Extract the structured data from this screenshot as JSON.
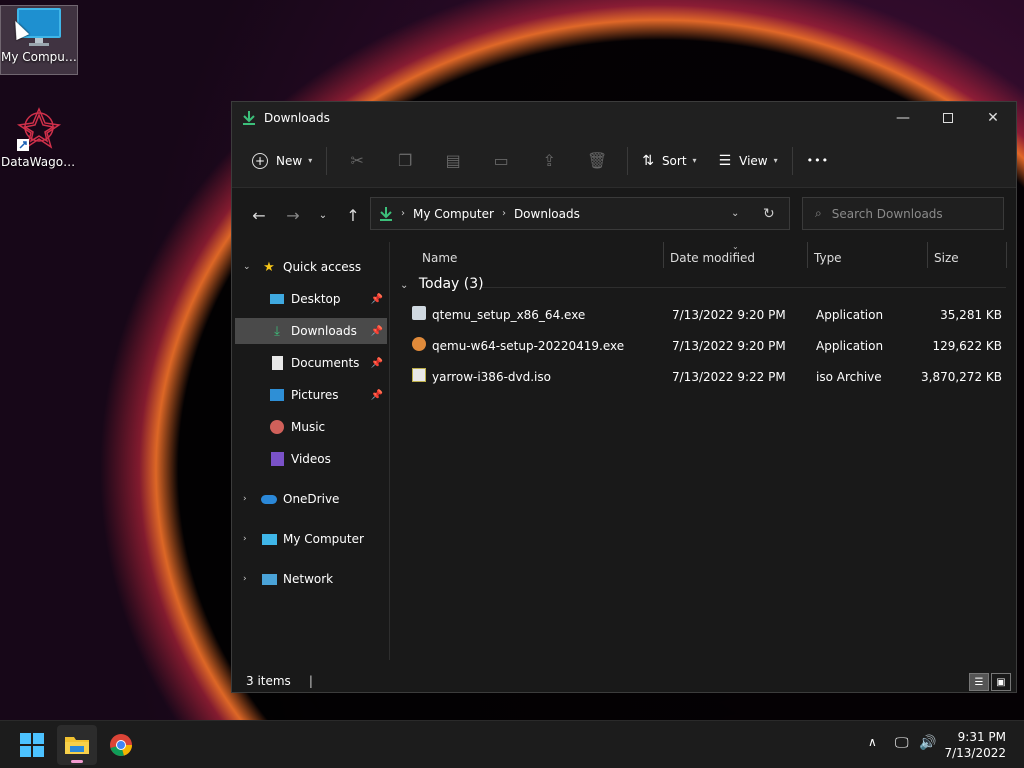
{
  "desktop": {
    "icons": [
      {
        "label": "My Computer"
      },
      {
        "label": "DataWagon..."
      }
    ]
  },
  "window": {
    "title": "Downloads",
    "commands": {
      "new": "New",
      "sort": "Sort",
      "view": "View",
      "more": "•••"
    },
    "address": {
      "part1": "My Computer",
      "part2": "Downloads"
    },
    "search": {
      "placeholder": "Search Downloads"
    },
    "sidebar": {
      "quick_access": "Quick access",
      "items": [
        {
          "label": "Desktop"
        },
        {
          "label": "Downloads"
        },
        {
          "label": "Documents"
        },
        {
          "label": "Pictures"
        },
        {
          "label": "Music"
        },
        {
          "label": "Videos"
        }
      ],
      "onedrive": "OneDrive",
      "mycomputer": "My Computer",
      "network": "Network"
    },
    "columns": {
      "name": "Name",
      "date": "Date modified",
      "type": "Type",
      "size": "Size"
    },
    "group": "Today (3)",
    "files": [
      {
        "name": "qtemu_setup_x86_64.exe",
        "date": "7/13/2022 9:20 PM",
        "type": "Application",
        "size": "35,281 KB"
      },
      {
        "name": "qemu-w64-setup-20220419.exe",
        "date": "7/13/2022 9:20 PM",
        "type": "Application",
        "size": "129,622 KB"
      },
      {
        "name": "yarrow-i386-dvd.iso",
        "date": "7/13/2022 9:22 PM",
        "type": "iso Archive",
        "size": "3,870,272 KB"
      }
    ],
    "status": {
      "count": "3 items",
      "cursor": "|"
    }
  },
  "taskbar": {
    "time": "9:31 PM",
    "date": "7/13/2022"
  }
}
